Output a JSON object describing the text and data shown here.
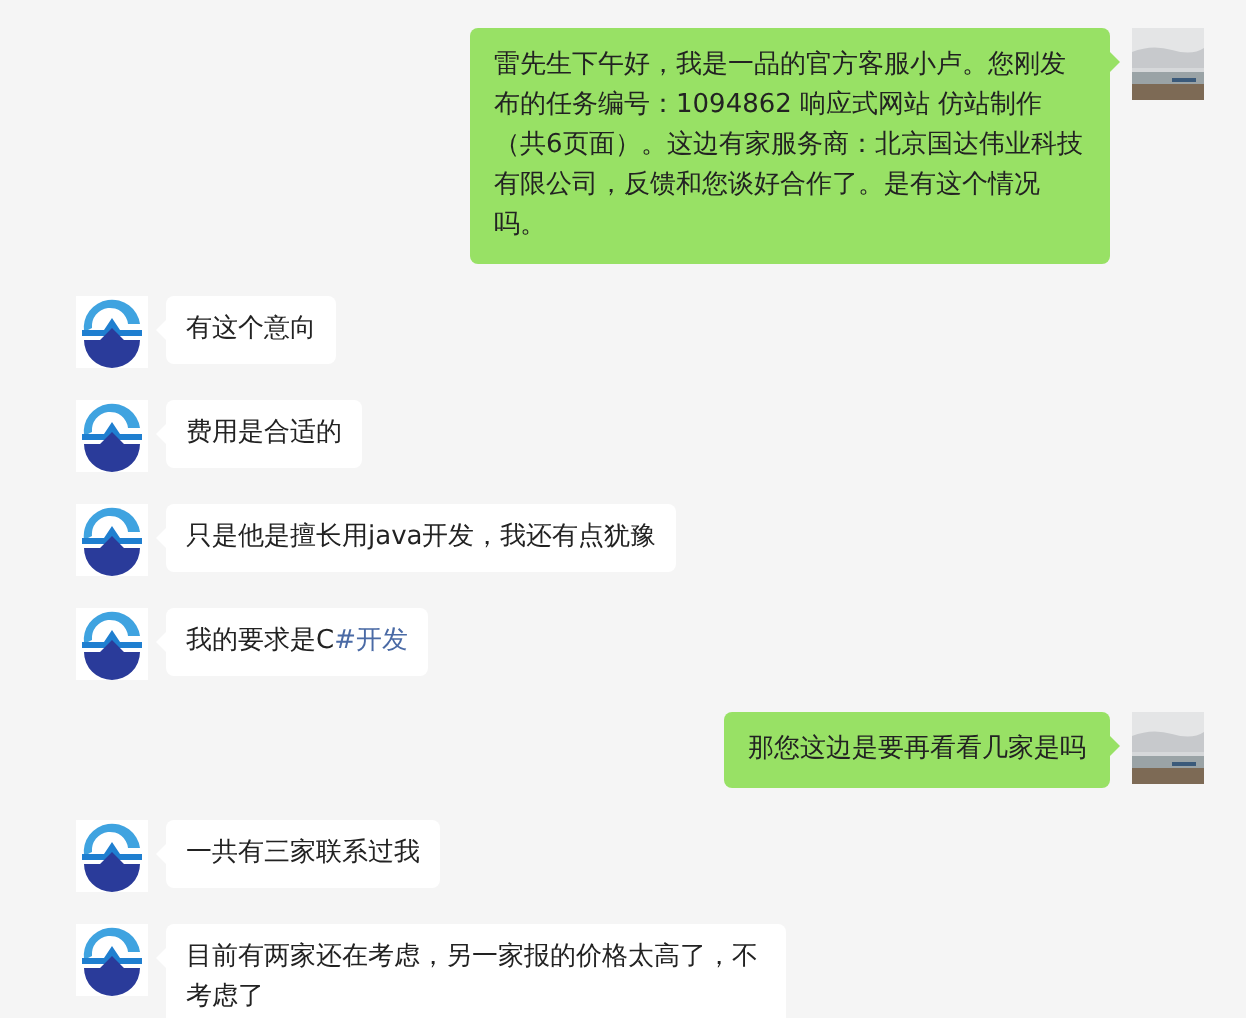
{
  "messages": [
    {
      "kind": "out",
      "text": "雷先生下午好，我是一品的官方客服小卢。您刚发布的任务编号：1094862 响应式网站 仿站制作（共6页面）。这边有家服务商：北京国达伟业科技有限公司，反馈和您谈好合作了。是有这个情况吗。"
    },
    {
      "kind": "in",
      "text": "有这个意向"
    },
    {
      "kind": "in",
      "text": "费用是合适的"
    },
    {
      "kind": "in",
      "text": "只是他是擅长用java开发，我还有点犹豫"
    },
    {
      "kind": "in",
      "text": "我的要求是C",
      "hashtag": "#开发"
    },
    {
      "kind": "out",
      "text": "那您这边是要再看看几家是吗"
    },
    {
      "kind": "in",
      "text": "一共有三家联系过我"
    },
    {
      "kind": "in",
      "text": "目前有两家还在考虑，另一家报的价格太高了，不考虑了"
    }
  ]
}
